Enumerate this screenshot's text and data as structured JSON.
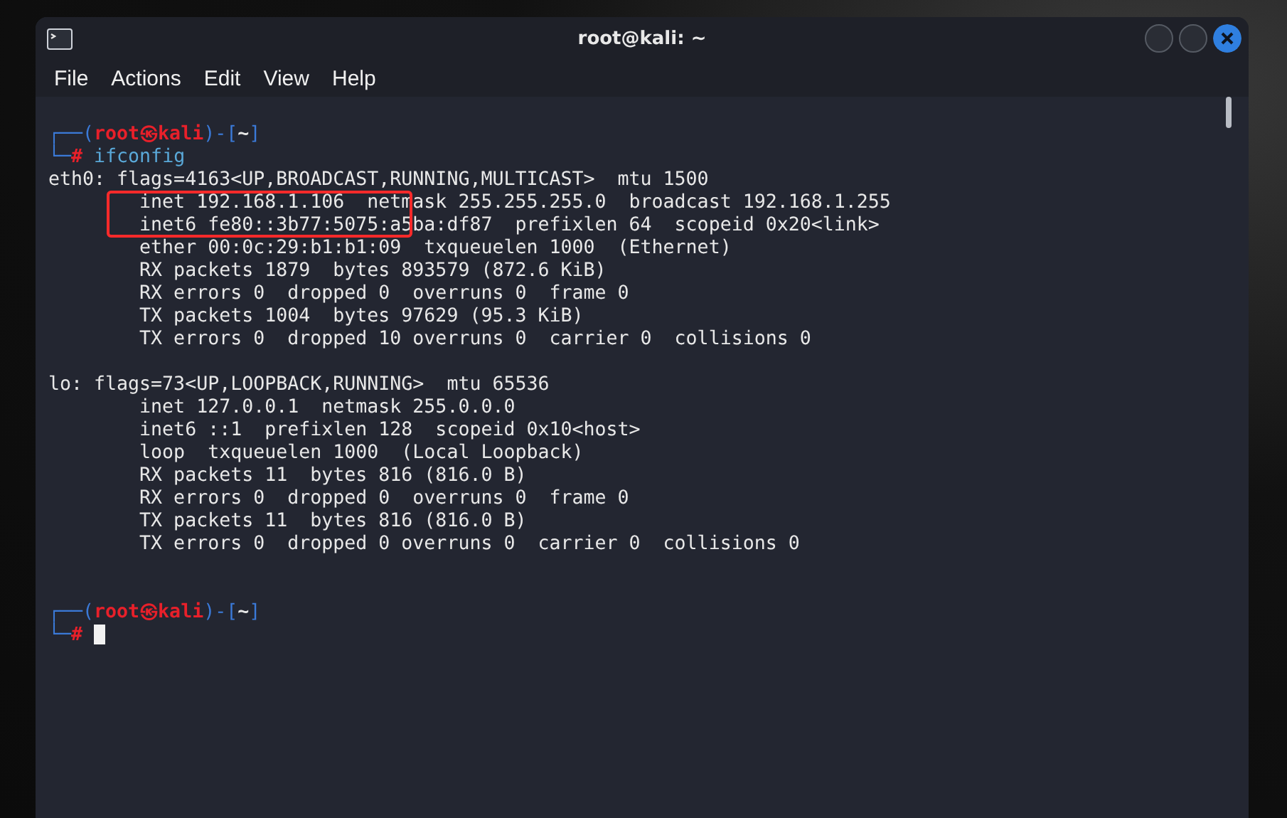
{
  "window": {
    "title": "root@kali: ~"
  },
  "menu": [
    "File",
    "Actions",
    "Edit",
    "View",
    "Help"
  ],
  "terminal": {
    "lines": [
      {
        "kind": "prompt",
        "open": "┌──(",
        "user": "root",
        "at": "㉿",
        "host": "kali",
        "mid": ")-[",
        "dir": "~",
        "close": "]"
      },
      {
        "kind": "command",
        "corner": "└─",
        "symbol": "#",
        "command": "ifconfig",
        "cursor": false
      },
      {
        "kind": "output",
        "text": "eth0: flags=4163<UP,BROADCAST,RUNNING,MULTICAST>  mtu 1500"
      },
      {
        "kind": "output",
        "text": "        inet 192.168.1.106  netmask 255.255.255.0  broadcast 192.168.1.255"
      },
      {
        "kind": "output",
        "text": "        inet6 fe80::3b77:5075:a5ba:df87  prefixlen 64  scopeid 0x20<link>"
      },
      {
        "kind": "output",
        "text": "        ether 00:0c:29:b1:b1:09  txqueuelen 1000  (Ethernet)"
      },
      {
        "kind": "output",
        "text": "        RX packets 1879  bytes 893579 (872.6 KiB)"
      },
      {
        "kind": "output",
        "text": "        RX errors 0  dropped 0  overruns 0  frame 0"
      },
      {
        "kind": "output",
        "text": "        TX packets 1004  bytes 97629 (95.3 KiB)"
      },
      {
        "kind": "output",
        "text": "        TX errors 0  dropped 10 overruns 0  carrier 0  collisions 0"
      },
      {
        "kind": "blank"
      },
      {
        "kind": "output",
        "text": "lo: flags=73<UP,LOOPBACK,RUNNING>  mtu 65536"
      },
      {
        "kind": "output",
        "text": "        inet 127.0.0.1  netmask 255.0.0.0"
      },
      {
        "kind": "output",
        "text": "        inet6 ::1  prefixlen 128  scopeid 0x10<host>"
      },
      {
        "kind": "output",
        "text": "        loop  txqueuelen 1000  (Local Loopback)"
      },
      {
        "kind": "output",
        "text": "        RX packets 11  bytes 816 (816.0 B)"
      },
      {
        "kind": "output",
        "text": "        RX errors 0  dropped 0  overruns 0  frame 0"
      },
      {
        "kind": "output",
        "text": "        TX packets 11  bytes 816 (816.0 B)"
      },
      {
        "kind": "output",
        "text": "        TX errors 0  dropped 0 overruns 0  carrier 0  collisions 0"
      },
      {
        "kind": "blank"
      },
      {
        "kind": "blank"
      },
      {
        "kind": "prompt",
        "open": "┌──(",
        "user": "root",
        "at": "㉿",
        "host": "kali",
        "mid": ")-[",
        "dir": "~",
        "close": "]"
      },
      {
        "kind": "command",
        "corner": "└─",
        "symbol": "#",
        "cursor": true
      }
    ]
  }
}
